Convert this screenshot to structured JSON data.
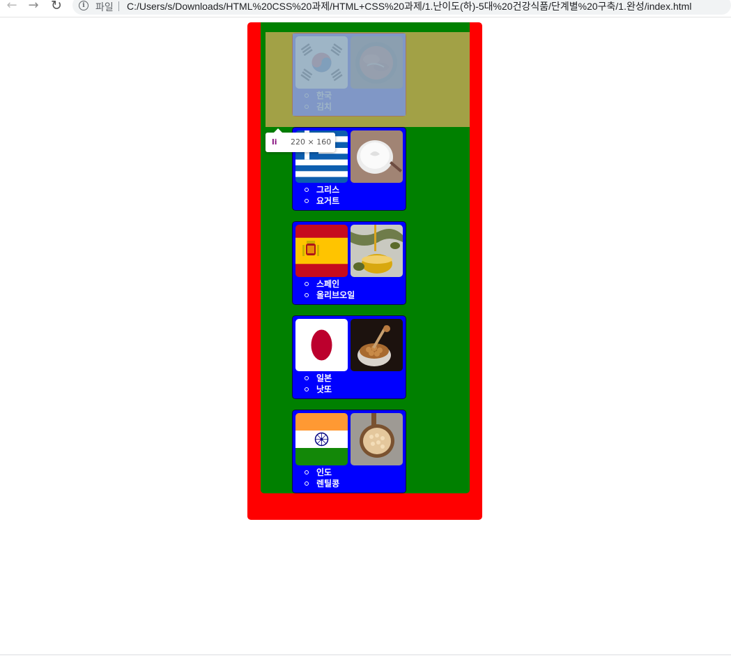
{
  "browser": {
    "back_icon": "←",
    "forward_icon": "→",
    "reload_icon": "↻",
    "scheme_label": "파일",
    "url": "C:/Users/s/Downloads/HTML%20CSS%20과제/HTML+CSS%20과제/1.난이도(하)-5대%20건강식품/단계별%20구축/1.완성/index.html"
  },
  "colors": {
    "outer": "#ff0000",
    "inner": "#008000",
    "card": "#0000ff"
  },
  "devtools_tooltip": {
    "tag": "li",
    "size": "220 × 160"
  },
  "items": [
    {
      "country": "한국",
      "food": "김치",
      "flag_icon": "korea-flag-icon",
      "food_icon": "kimchi-photo"
    },
    {
      "country": "그리스",
      "food": "요거트",
      "flag_icon": "greece-flag-icon",
      "food_icon": "yogurt-photo"
    },
    {
      "country": "스페인",
      "food": "올리브오일",
      "flag_icon": "spain-flag-icon",
      "food_icon": "olive-oil-photo"
    },
    {
      "country": "일본",
      "food": "낫또",
      "flag_icon": "japan-flag-icon",
      "food_icon": "natto-photo"
    },
    {
      "country": "인도",
      "food": "렌틸콩",
      "flag_icon": "india-flag-icon",
      "food_icon": "lentil-photo"
    }
  ]
}
